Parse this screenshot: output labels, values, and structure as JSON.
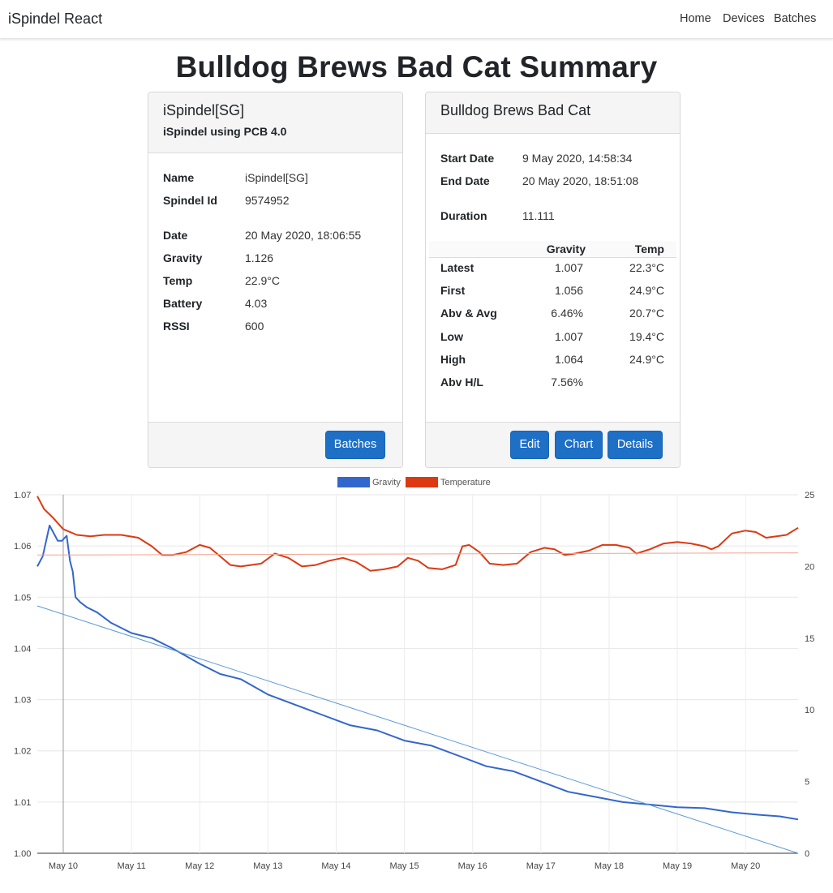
{
  "navbar": {
    "brand": "iSpindel React",
    "links": [
      "Home",
      "Devices",
      "Batches"
    ]
  },
  "page_title": "Bulldog Brews Bad Cat Summary",
  "device_card": {
    "title": "iSpindel[SG]",
    "subtitle": "iSpindel using PCB 4.0",
    "fields": [
      {
        "label": "Name",
        "value": "iSpindel[SG]"
      },
      {
        "label": "Spindel Id",
        "value": "9574952"
      },
      {
        "label": "Date",
        "value": "20 May 2020, 18:06:55"
      },
      {
        "label": "Gravity",
        "value": "1.126"
      },
      {
        "label": "Temp",
        "value": "22.9°C"
      },
      {
        "label": "Battery",
        "value": "4.03"
      },
      {
        "label": "RSSI",
        "value": "600"
      }
    ],
    "button": "Batches"
  },
  "batch_card": {
    "title": "Bulldog Brews Bad Cat",
    "fields": [
      {
        "label": "Start Date",
        "value": "9 May 2020, 14:58:34"
      },
      {
        "label": "End Date",
        "value": "20 May 2020, 18:51:08"
      },
      {
        "label": "Duration",
        "value": "11.111"
      }
    ],
    "stats_headers": [
      "Gravity",
      "Temp"
    ],
    "stats": [
      {
        "label": "Latest",
        "gravity": "1.007",
        "temp": "22.3°C"
      },
      {
        "label": "First",
        "gravity": "1.056",
        "temp": "24.9°C"
      },
      {
        "label": "Abv & Avg",
        "gravity": "6.46%",
        "temp": "20.7°C"
      },
      {
        "label": "Low",
        "gravity": "1.007",
        "temp": "19.4°C"
      },
      {
        "label": "High",
        "gravity": "1.064",
        "temp": "24.9°C"
      },
      {
        "label": "Abv H/L",
        "gravity": "7.56%",
        "temp": ""
      }
    ],
    "buttons": [
      "Edit",
      "Chart",
      "Details"
    ]
  },
  "colors": {
    "gravity": "#3366cc",
    "temperature": "#dc3912",
    "button": "#1e6fc6",
    "trend_gravity": "#5b9bd5",
    "avg_temp": "#f4a38f"
  },
  "chart_data": {
    "type": "line",
    "legend": [
      "Gravity",
      "Temperature"
    ],
    "legend_position": "top",
    "x_ticks": [
      "May 10",
      "May 11",
      "May 12",
      "May 13",
      "May 14",
      "May 15",
      "May 16",
      "May 17",
      "May 18",
      "May 19",
      "May 20"
    ],
    "x_range": [
      9.62,
      20.77
    ],
    "y_left_ticks": [
      "1.00",
      "1.01",
      "1.02",
      "1.03",
      "1.04",
      "1.05",
      "1.06",
      "1.07"
    ],
    "y_left_range": [
      1.0,
      1.07
    ],
    "y_right_ticks": [
      "0",
      "5",
      "10",
      "15",
      "20",
      "25"
    ],
    "y_right_range": [
      0,
      25
    ],
    "grid": true,
    "series": [
      {
        "name": "Gravity",
        "axis": "left",
        "points": [
          [
            9.62,
            1.056
          ],
          [
            9.7,
            1.058
          ],
          [
            9.8,
            1.064
          ],
          [
            9.88,
            1.062
          ],
          [
            9.92,
            1.061
          ],
          [
            9.98,
            1.061
          ],
          [
            10.05,
            1.062
          ],
          [
            10.1,
            1.057
          ],
          [
            10.14,
            1.055
          ],
          [
            10.18,
            1.05
          ],
          [
            10.25,
            1.049
          ],
          [
            10.35,
            1.048
          ],
          [
            10.5,
            1.047
          ],
          [
            10.7,
            1.045
          ],
          [
            11.0,
            1.043
          ],
          [
            11.3,
            1.042
          ],
          [
            11.6,
            1.04
          ],
          [
            12.0,
            1.037
          ],
          [
            12.3,
            1.035
          ],
          [
            12.6,
            1.034
          ],
          [
            13.0,
            1.031
          ],
          [
            13.4,
            1.029
          ],
          [
            13.8,
            1.027
          ],
          [
            14.2,
            1.025
          ],
          [
            14.6,
            1.024
          ],
          [
            15.0,
            1.022
          ],
          [
            15.4,
            1.021
          ],
          [
            15.8,
            1.019
          ],
          [
            16.2,
            1.017
          ],
          [
            16.6,
            1.016
          ],
          [
            17.0,
            1.014
          ],
          [
            17.4,
            1.012
          ],
          [
            17.8,
            1.011
          ],
          [
            18.2,
            1.01
          ],
          [
            18.6,
            1.0095
          ],
          [
            19.0,
            1.009
          ],
          [
            19.4,
            1.0088
          ],
          [
            19.8,
            1.008
          ],
          [
            20.2,
            1.0075
          ],
          [
            20.5,
            1.0072
          ],
          [
            20.77,
            1.0066
          ]
        ]
      },
      {
        "name": "Temperature",
        "axis": "right",
        "points": [
          [
            9.62,
            24.9
          ],
          [
            9.72,
            24.0
          ],
          [
            9.85,
            23.4
          ],
          [
            10.0,
            22.6
          ],
          [
            10.2,
            22.2
          ],
          [
            10.4,
            22.1
          ],
          [
            10.6,
            22.2
          ],
          [
            10.85,
            22.2
          ],
          [
            11.1,
            22.0
          ],
          [
            11.3,
            21.4
          ],
          [
            11.45,
            20.8
          ],
          [
            11.6,
            20.8
          ],
          [
            11.8,
            21.0
          ],
          [
            12.0,
            21.5
          ],
          [
            12.15,
            21.3
          ],
          [
            12.3,
            20.7
          ],
          [
            12.45,
            20.1
          ],
          [
            12.6,
            20.0
          ],
          [
            12.9,
            20.2
          ],
          [
            13.1,
            20.9
          ],
          [
            13.3,
            20.6
          ],
          [
            13.5,
            20.0
          ],
          [
            13.7,
            20.1
          ],
          [
            13.9,
            20.4
          ],
          [
            14.1,
            20.6
          ],
          [
            14.3,
            20.3
          ],
          [
            14.5,
            19.7
          ],
          [
            14.7,
            19.8
          ],
          [
            14.9,
            20.0
          ],
          [
            15.05,
            20.6
          ],
          [
            15.2,
            20.4
          ],
          [
            15.35,
            19.9
          ],
          [
            15.55,
            19.8
          ],
          [
            15.75,
            20.1
          ],
          [
            15.85,
            21.4
          ],
          [
            15.95,
            21.5
          ],
          [
            16.1,
            21.0
          ],
          [
            16.25,
            20.2
          ],
          [
            16.45,
            20.1
          ],
          [
            16.65,
            20.2
          ],
          [
            16.85,
            21.0
          ],
          [
            17.05,
            21.3
          ],
          [
            17.2,
            21.2
          ],
          [
            17.35,
            20.8
          ],
          [
            17.5,
            20.9
          ],
          [
            17.7,
            21.1
          ],
          [
            17.9,
            21.5
          ],
          [
            18.1,
            21.5
          ],
          [
            18.3,
            21.3
          ],
          [
            18.4,
            20.9
          ],
          [
            18.6,
            21.2
          ],
          [
            18.8,
            21.6
          ],
          [
            19.0,
            21.7
          ],
          [
            19.2,
            21.6
          ],
          [
            19.4,
            21.4
          ],
          [
            19.5,
            21.2
          ],
          [
            19.6,
            21.4
          ],
          [
            19.8,
            22.3
          ],
          [
            20.0,
            22.5
          ],
          [
            20.15,
            22.4
          ],
          [
            20.3,
            22.0
          ],
          [
            20.45,
            22.1
          ],
          [
            20.6,
            22.2
          ],
          [
            20.77,
            22.7
          ]
        ]
      },
      {
        "name": "Gravity trend",
        "axis": "left",
        "points": [
          [
            9.62,
            1.0483
          ],
          [
            20.77,
            1.0
          ]
        ]
      },
      {
        "name": "Average temperature",
        "axis": "right",
        "points": [
          [
            9.62,
            20.8
          ],
          [
            20.77,
            20.95
          ]
        ]
      }
    ],
    "cursor_x": 10.0
  }
}
